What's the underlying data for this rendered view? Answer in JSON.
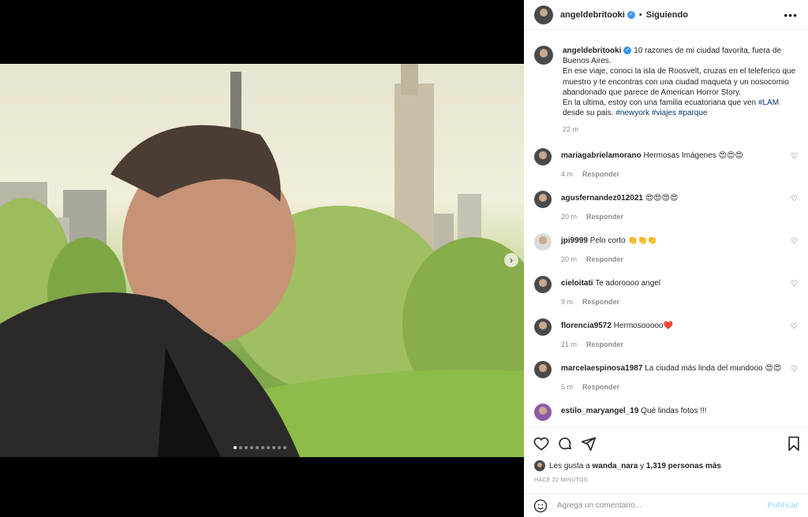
{
  "post": {
    "username": "angeldebritooki",
    "follow_state": "Siguiendo",
    "bullet": "•",
    "more": "•••"
  },
  "caption": {
    "username": "angeldebritooki",
    "line1": "10 razones de mi ciudad favorita, fuera de Buenos Aires.",
    "line2": "En ese viaje, conoci la isla de Roosvelt, cruzas en el teleferico que muestro y te encontras con una ciudad maqueta y un nosocomio abandonado que parece de American Horror Story.",
    "line3_pre": "En la ultima, estoy con una familia ecuatoriana que ven",
    "line3_tag": "#LAM",
    "line3_post": "desde su pais.",
    "tags": "#newyork #viajes #parque",
    "time": "22 m"
  },
  "comments": [
    {
      "user": "mariagabrielamorano",
      "text": "Hermosas Imágenes 😍😍😍",
      "time": "4 m",
      "reply": "Responder"
    },
    {
      "user": "agusfernandez012021",
      "text": "😍😍😍😍",
      "time": "20 m",
      "reply": "Responder"
    },
    {
      "user": "jpi9999",
      "text": "Pelo corto 👏👏👏",
      "time": "20 m",
      "reply": "Responder"
    },
    {
      "user": "cieloitati",
      "text": "Te adoroooo angel",
      "time": "9 m",
      "reply": "Responder"
    },
    {
      "user": "florencia9572",
      "text": "Hermosooooo❤️",
      "time": "21 m",
      "reply": "Responder"
    },
    {
      "user": "marcelaespinosa1987",
      "text": "La ciudad más linda del mundooo 😍😍",
      "time": "5 m",
      "reply": "Responder"
    },
    {
      "user": "estilo_maryangel_19",
      "text": "Qué lindas fotos !!!",
      "time": "",
      "reply": ""
    }
  ],
  "likes": {
    "prefix": "Les gusta a",
    "user": "wanda_nara",
    "mid": "y",
    "count": "1,319 personas más"
  },
  "posted_ago": "HACE 22 MINUTOS",
  "add_comment": {
    "placeholder": "Agrega un comentario...",
    "publish": "Publicar"
  },
  "carousel": {
    "total": 10,
    "active": 1
  }
}
